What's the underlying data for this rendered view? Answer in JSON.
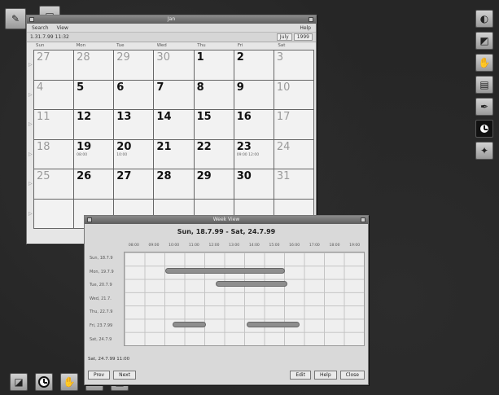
{
  "month_window": {
    "title": "Jan",
    "menu": [
      "Search",
      "View",
      "Help"
    ],
    "date_time": "1.31.7.99  11:32",
    "month_label": "July",
    "year_label": "1999",
    "day_names": [
      "Sun",
      "Mon",
      "Tue",
      "Wed",
      "Thu",
      "Fri",
      "Sat"
    ],
    "weeks": [
      [
        {
          "d": "27",
          "dim": true
        },
        {
          "d": "28",
          "dim": true
        },
        {
          "d": "29",
          "dim": true
        },
        {
          "d": "30",
          "dim": true
        },
        {
          "d": "1"
        },
        {
          "d": "2"
        },
        {
          "d": "3",
          "dim": true
        }
      ],
      [
        {
          "d": "4",
          "dim": true
        },
        {
          "d": "5"
        },
        {
          "d": "6"
        },
        {
          "d": "7"
        },
        {
          "d": "8"
        },
        {
          "d": "9"
        },
        {
          "d": "10",
          "dim": true
        }
      ],
      [
        {
          "d": "11",
          "dim": true
        },
        {
          "d": "12"
        },
        {
          "d": "13"
        },
        {
          "d": "14"
        },
        {
          "d": "15"
        },
        {
          "d": "16"
        },
        {
          "d": "17",
          "dim": true
        }
      ],
      [
        {
          "d": "18",
          "dim": true
        },
        {
          "d": "19",
          "ev": "08:00"
        },
        {
          "d": "20",
          "ev": "10:00"
        },
        {
          "d": "21"
        },
        {
          "d": "22"
        },
        {
          "d": "23",
          "ev": "09:00 12:00"
        },
        {
          "d": "24",
          "dim": true
        }
      ],
      [
        {
          "d": "25",
          "dim": true
        },
        {
          "d": "26"
        },
        {
          "d": "27"
        },
        {
          "d": "28"
        },
        {
          "d": "29"
        },
        {
          "d": "30"
        },
        {
          "d": "31",
          "dim": true
        }
      ],
      [
        {
          "d": ""
        },
        {
          "d": ""
        },
        {
          "d": ""
        },
        {
          "d": ""
        },
        {
          "d": ""
        },
        {
          "d": ""
        },
        {
          "d": ""
        }
      ]
    ]
  },
  "week_window": {
    "title": "Week View",
    "range_label": "Sun, 18.7.99 - Sat, 24.7.99",
    "hours": [
      "08:00",
      "09:00",
      "10:00",
      "11:00",
      "12:00",
      "13:00",
      "14:00",
      "15:00",
      "16:00",
      "17:00",
      "18:00",
      "19:00"
    ],
    "days": [
      "Sun, 18.7.9",
      "Mon, 19.7.9",
      "Tue, 20.7.9",
      "Wed, 21.7.",
      "Thu, 22.7.9",
      "Fri, 23.7.99",
      "Sat, 24.7.9"
    ],
    "status": "Sat, 24.7.99  11:00",
    "buttons": {
      "prev": "Prev",
      "next": "Next",
      "edit": "Edit",
      "help": "Help",
      "close": "Close"
    }
  },
  "dock_left_top": [
    {
      "name": "pen-icon",
      "glyph": "✎"
    },
    {
      "name": "terminal-icon",
      "glyph": "▣"
    }
  ],
  "dock_right": [
    {
      "name": "swirl-icon",
      "glyph": "◐"
    },
    {
      "name": "window-icon",
      "glyph": "◩"
    },
    {
      "name": "hand-icon",
      "glyph": "✋"
    },
    {
      "name": "document-icon",
      "glyph": "▤"
    },
    {
      "name": "pen-tool-icon",
      "glyph": "✒"
    },
    {
      "name": "clock-icon",
      "glyph": ""
    },
    {
      "name": "wand-icon",
      "glyph": "✦"
    }
  ],
  "dock_bottom": [
    {
      "name": "workspace-icon",
      "glyph": "◪"
    },
    {
      "name": "clock-icon",
      "glyph": ""
    },
    {
      "name": "hand-icon",
      "glyph": "✋"
    },
    {
      "name": "card-icon",
      "glyph": "▭"
    },
    {
      "name": "window-icon",
      "glyph": "◩"
    }
  ]
}
